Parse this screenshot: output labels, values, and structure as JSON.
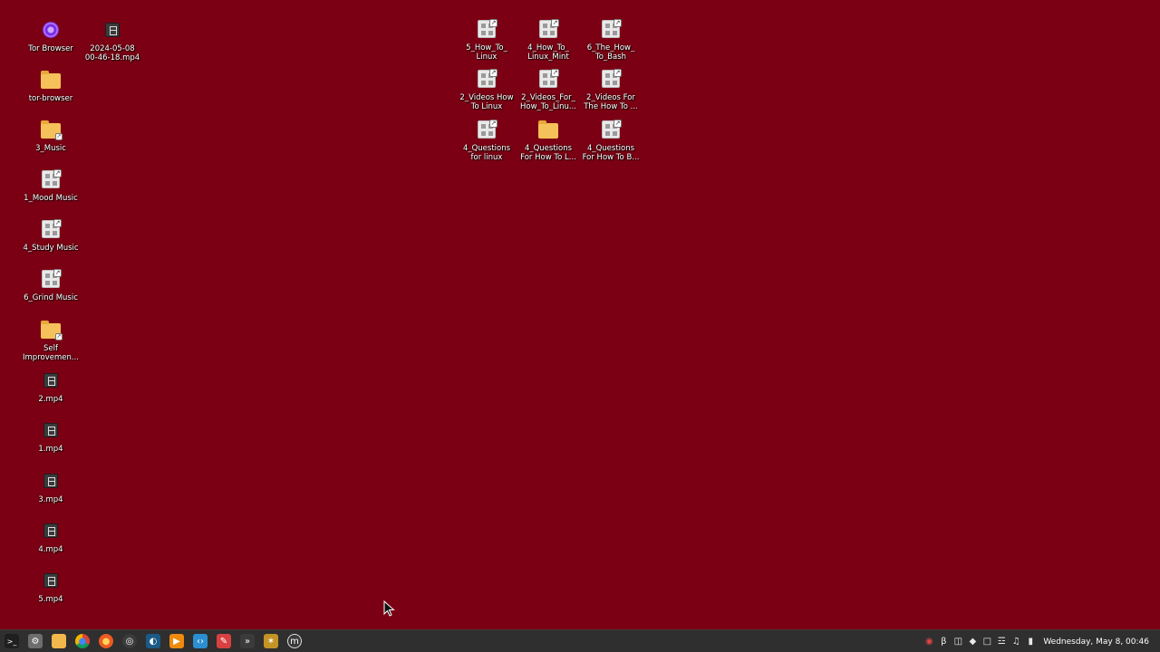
{
  "desktop": {
    "icons": [
      {
        "label": "Tor Browser",
        "kind": "tor-icon"
      },
      {
        "label": "2024-05-08\n00-46-18.mp4",
        "kind": "video-file-icon"
      },
      {
        "label": "tor-browser",
        "kind": "folder-icon"
      },
      {
        "label": "3_Music",
        "kind": "folder-link-icon"
      },
      {
        "label": "1_Mood Music",
        "kind": "file-link-icon"
      },
      {
        "label": "4_Study Music",
        "kind": "file-link-icon"
      },
      {
        "label": "6_Grind Music",
        "kind": "file-link-icon"
      },
      {
        "label": "Self\nImprovemen...",
        "kind": "folder-link-icon"
      },
      {
        "label": "2.mp4",
        "kind": "video-file-icon"
      },
      {
        "label": "1.mp4",
        "kind": "video-file-icon"
      },
      {
        "label": "3.mp4",
        "kind": "video-file-icon"
      },
      {
        "label": "4.mp4",
        "kind": "video-file-icon"
      },
      {
        "label": "5.mp4",
        "kind": "video-file-icon"
      },
      {
        "label": "5_How_To_\nLinux",
        "kind": "file-link-icon"
      },
      {
        "label": "4_How_To_\nLinux_Mint",
        "kind": "file-link-icon"
      },
      {
        "label": "6_The_How_\nTo_Bash",
        "kind": "file-link-icon"
      },
      {
        "label": "2_Videos How\nTo Linux",
        "kind": "file-link-icon"
      },
      {
        "label": "2_Videos_For_\nHow_To_Linu...",
        "kind": "file-link-icon"
      },
      {
        "label": "2_Videos For\nThe How To ...",
        "kind": "file-link-icon"
      },
      {
        "label": "4_Questions\nfor linux",
        "kind": "file-link-icon"
      },
      {
        "label": "4_Questions\nFor How To L...",
        "kind": "folder-icon"
      },
      {
        "label": "4_Questions\nFor How To B...",
        "kind": "file-link-icon"
      }
    ]
  },
  "taskbar": {
    "launchers": [
      {
        "name": "terminal-icon",
        "glyph": ">_",
        "color": "#1f1f1f"
      },
      {
        "name": "system-settings-icon",
        "glyph": "⚙",
        "color": "#6d6d6d"
      },
      {
        "name": "file-manager-icon",
        "glyph": "",
        "color": "#f2b84b"
      },
      {
        "name": "chrome-icon",
        "glyph": "●",
        "color": "#2a7fd6"
      },
      {
        "name": "firefox-icon",
        "glyph": "●",
        "color": "#ec5b21"
      },
      {
        "name": "obs-icon",
        "glyph": "◎",
        "color": "#3b3b3b"
      },
      {
        "name": "steam-icon",
        "glyph": "◐",
        "color": "#1b5a86"
      },
      {
        "name": "vlc-icon",
        "glyph": "▶",
        "color": "#f08a0c"
      },
      {
        "name": "vscode-icon",
        "glyph": "‹›",
        "color": "#2b8fd1"
      },
      {
        "name": "lowriter-icon",
        "glyph": "✎",
        "color": "#d94040"
      },
      {
        "name": "kdenlive-icon",
        "glyph": "»",
        "color": "#3b3b3b"
      },
      {
        "name": "synaptic-icon",
        "glyph": "✶",
        "color": "#c49325"
      },
      {
        "name": "mint-menu-icon",
        "glyph": "m",
        "color": "#3a3a3a"
      }
    ],
    "tray": [
      {
        "name": "update-manager-icon",
        "glyph": "◉"
      },
      {
        "name": "bluetooth-icon",
        "glyph": "β"
      },
      {
        "name": "workspace-switcher-icon",
        "glyph": "◫"
      },
      {
        "name": "shield-icon",
        "glyph": "◆"
      },
      {
        "name": "notes-icon",
        "glyph": "□"
      },
      {
        "name": "network-wifi-icon",
        "glyph": "☲"
      },
      {
        "name": "sound-icon",
        "glyph": "♫"
      },
      {
        "name": "power-icon",
        "glyph": "▮"
      }
    ],
    "clock": "Wednesday, May 8, 00:46"
  }
}
